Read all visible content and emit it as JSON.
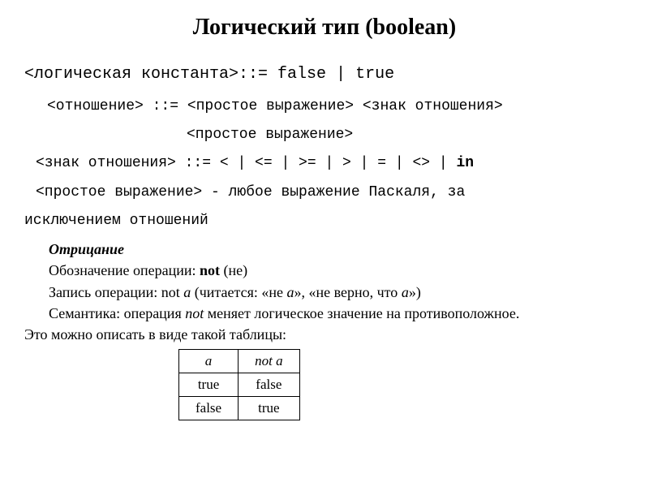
{
  "title": "Логический тип (boolean)",
  "bnf": {
    "logical_constant": "<логическая константа>::= false | true",
    "relation_line1": "<отношение> ::= <простое   выражение> <знак отношения>",
    "relation_line2": "<простое выражение>",
    "relation_sign": "<знак отношения> ::= < | <= | >= | > | = | <> | ",
    "relation_sign_tail": "in",
    "simple_expr": "<простое выражение> - любое выражение Паскаля, за",
    "simple_expr_tail": "исключением отношений"
  },
  "negation": {
    "heading": "Отрицание",
    "notation_label": "Обозначение операции: ",
    "notation_value": "not",
    "notation_tail": " (не)",
    "record_label": "Запись операции: not ",
    "record_var": "a",
    "record_tail": "  (читается: «не ",
    "record_tail_var": "a",
    "record_tail2": "», «не верно, что ",
    "record_tail_var2": "a",
    "record_tail3": "»)",
    "semantics_lead": "Семантика: операция ",
    "semantics_op": "not",
    "semantics_tail": " меняет логическое значение на противоположное.",
    "semantics_line2": "Это можно описать в виде такой таблицы:"
  },
  "chart_data": {
    "type": "table",
    "title": "Truth table for not",
    "columns": [
      "a",
      "not a"
    ],
    "rows": [
      [
        "true",
        "false"
      ],
      [
        "false",
        "true"
      ]
    ]
  }
}
